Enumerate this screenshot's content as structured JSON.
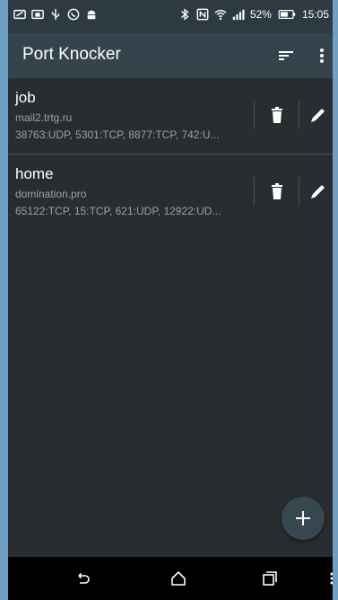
{
  "status_bar": {
    "battery_percent": "52%",
    "time": "15:05",
    "icons": [
      "message-icon",
      "screenshot-icon",
      "usb-icon",
      "whatsapp-icon",
      "android-icon",
      "bluetooth-icon",
      "nfc-icon",
      "wifi-icon",
      "signal-icon",
      "battery-icon"
    ]
  },
  "app_bar": {
    "title": "Port Knocker",
    "icons": [
      "sort-icon",
      "more-vert-icon"
    ]
  },
  "items": [
    {
      "title": "job",
      "host": "mail2.trtg.ru",
      "ports": "38763:UDP, 5301:TCP, 8877:TCP, 742:U..."
    },
    {
      "title": "home",
      "host": "domination.pro",
      "ports": "65122:TCP, 15:TCP, 621:UDP, 12922:UD..."
    }
  ],
  "fab": {
    "icon": "add-icon"
  },
  "nav_bar": {
    "icons": [
      "back-icon",
      "home-icon",
      "recents-icon",
      "menu-icon"
    ]
  }
}
